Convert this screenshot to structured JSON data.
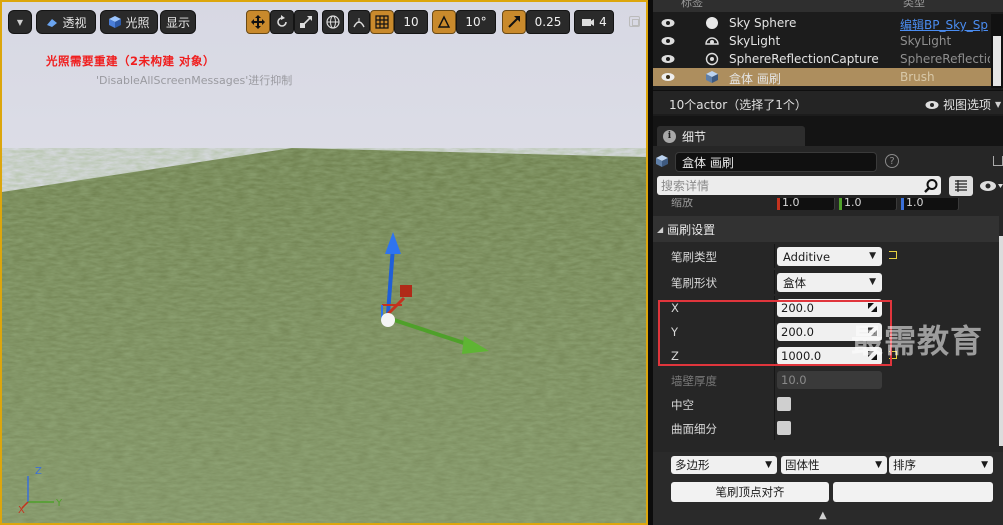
{
  "viewport": {
    "perspective_label": "透视",
    "lighting_label": "光照",
    "show_label": "显示",
    "grid_snap_value": "10",
    "rotation_snap_value": "10°",
    "scale_snap_value": "0.25",
    "camera_speed_value": "4",
    "warning_text": "光照需要重建（2未构建 对象）",
    "suppress_text": "'DisableAllScreenMessages'进行抑制",
    "axis": {
      "x": "X",
      "y": "Y",
      "z": "Z"
    }
  },
  "outliner": {
    "header_label": "标签",
    "header_type": "类型",
    "rows": [
      {
        "name": "Sky Sphere",
        "type": "编辑BP_Sky_Sp"
      },
      {
        "name": "SkyLight",
        "type": "SkyLight"
      },
      {
        "name": "SphereReflectionCapture",
        "type": "SphereReflection"
      },
      {
        "name": "盒体 画刷",
        "type": "Brush"
      }
    ],
    "count_text": "10个actor（选择了1个）",
    "view_options": "视图选项"
  },
  "details": {
    "tab_label": "细节",
    "actor_name": "盒体 画刷",
    "search_placeholder": "搜索详情",
    "scale_label": "缩放",
    "scale_values": [
      "1.0",
      "1.0",
      "1.0"
    ],
    "section_title": "画刷设置",
    "brush_type_label": "笔刷类型",
    "brush_type_value": "Additive",
    "brush_shape_label": "笔刷形状",
    "brush_shape_value": "盒体",
    "x_label": "X",
    "x_value": "200.0",
    "y_label": "Y",
    "y_value": "200.0",
    "z_label": "Z",
    "z_value": "1000.0",
    "wall_label": "墙壁厚度",
    "wall_value": "10.0",
    "hollow_label": "中空",
    "tessellated_label": "曲面细分",
    "polygons_value": "多边形",
    "solidity_value": "固体性",
    "order_value": "排序",
    "align_vertices_label": "笔刷顶点对齐",
    "watermark": "最需教育"
  },
  "colors": {
    "accent": "#dca60c",
    "selection": "#ad8e5e",
    "warning": "#f01e1e",
    "highlight": "#e0353c"
  }
}
